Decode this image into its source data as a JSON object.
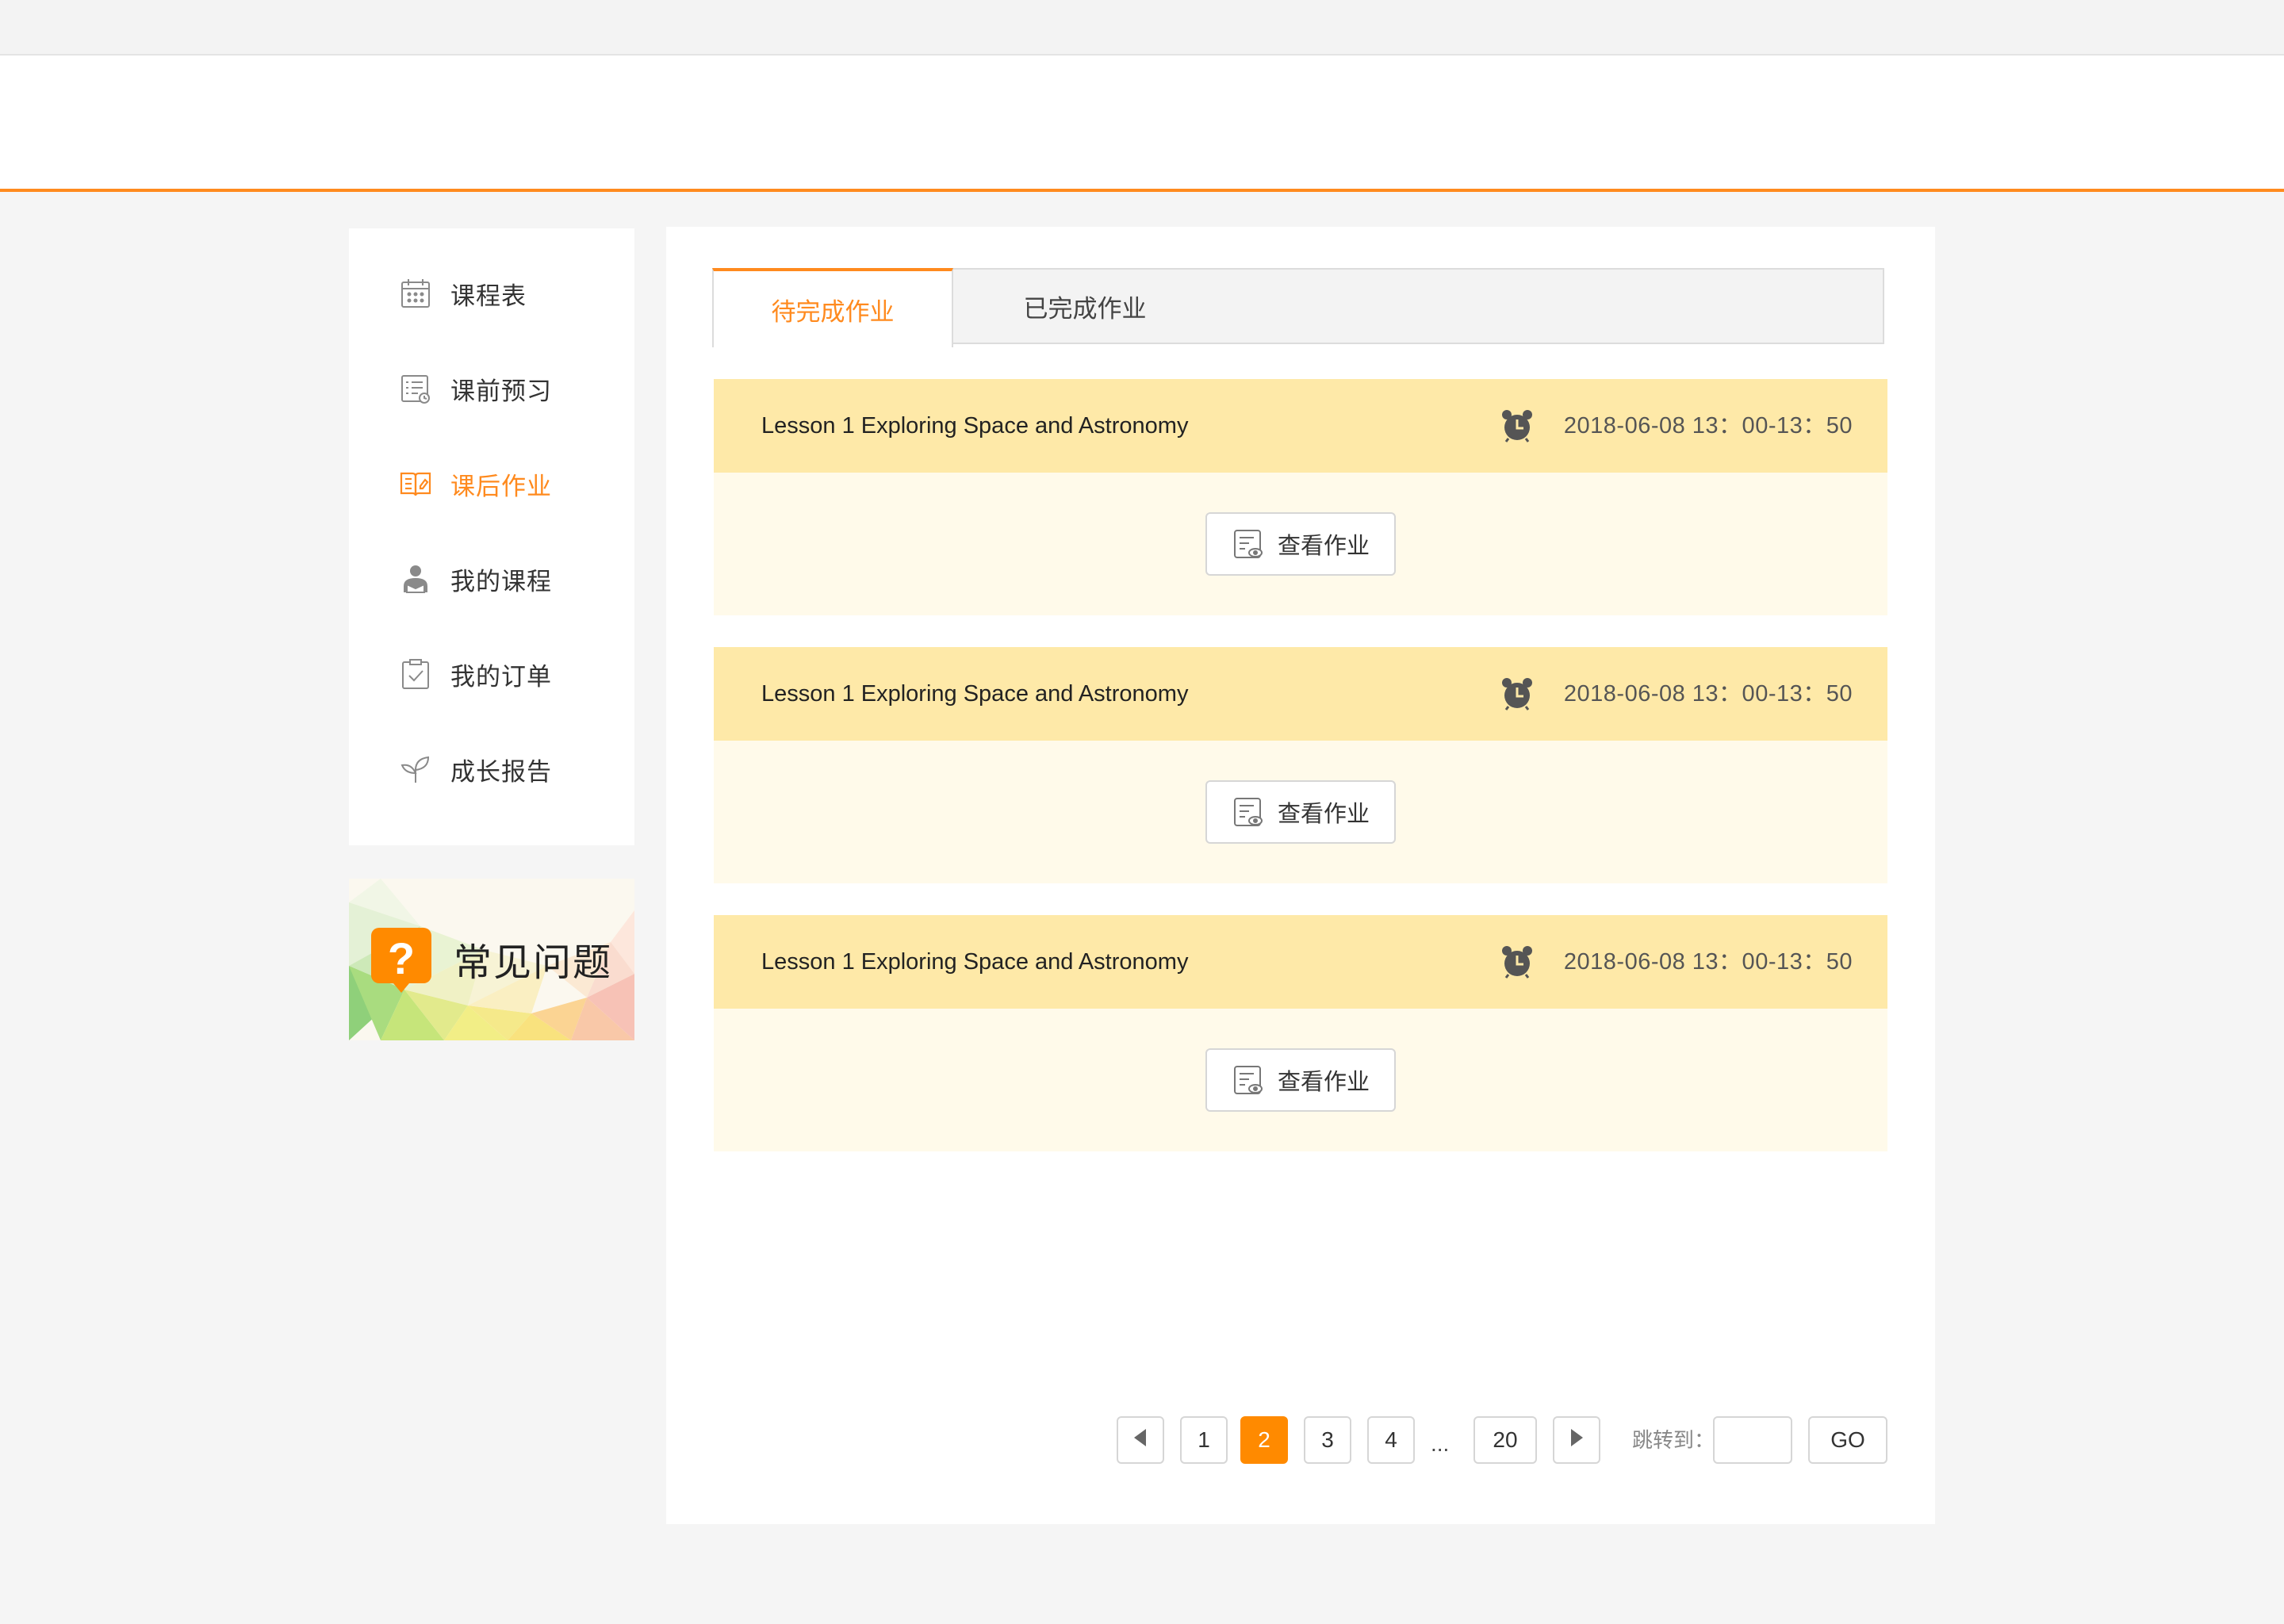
{
  "sidebar": {
    "items": [
      {
        "label": "课程表",
        "icon": "calendar-icon"
      },
      {
        "label": "课前预习",
        "icon": "list-clock-icon"
      },
      {
        "label": "课后作业",
        "icon": "open-book-icon",
        "active": true
      },
      {
        "label": "我的课程",
        "icon": "student-icon"
      },
      {
        "label": "我的订单",
        "icon": "clipboard-check-icon"
      },
      {
        "label": "成长报告",
        "icon": "sprout-icon"
      }
    ]
  },
  "faq": {
    "label": "常见问题",
    "icon": "question-bubble-icon"
  },
  "tabs": {
    "active": "待完成作业",
    "inactive": "已完成作业"
  },
  "cards": [
    {
      "title": "Lesson 1 Exploring Space and Astronomy",
      "time": "2018-06-08  13：00-13：50",
      "button": "查看作业"
    },
    {
      "title": "Lesson 1 Exploring Space and Astronomy",
      "time": "2018-06-08  13：00-13：50",
      "button": "查看作业"
    },
    {
      "title": "Lesson 1 Exploring Space and Astronomy",
      "time": "2018-06-08  13：00-13：50",
      "button": "查看作业"
    }
  ],
  "pagination": {
    "pages": [
      "1",
      "2",
      "3",
      "4"
    ],
    "current": "2",
    "ellipsis": "...",
    "last": "20",
    "jump_label": "跳转到：",
    "jump_value": "",
    "go_label": "GO"
  },
  "colors": {
    "accent": "#ff8a1e",
    "card_head": "#fee9a8",
    "card_body": "#fffaea",
    "page_bg": "#f5f5f5"
  }
}
